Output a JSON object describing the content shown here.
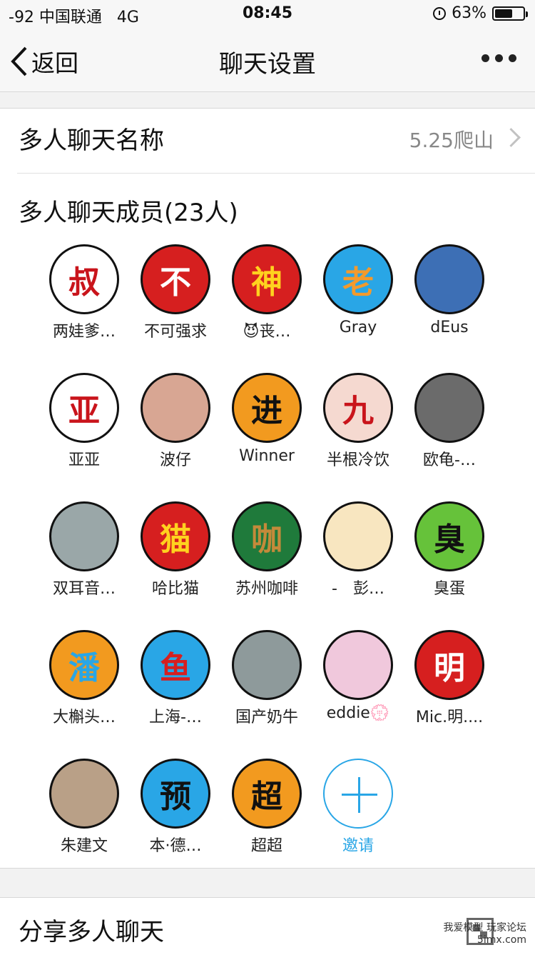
{
  "status": {
    "carrier": "-92 中国联通",
    "network": "4G",
    "time": "08:45",
    "battery": "63%",
    "battery_level": 0.63
  },
  "nav": {
    "back_label": "返回",
    "title": "聊天设置"
  },
  "group_name": {
    "label": "多人聊天名称",
    "value": "5.25爬山"
  },
  "members_title": "多人聊天成员(23人)",
  "members": [
    {
      "name": "两娃爹…",
      "glyph": "叔",
      "color": "#ffffff",
      "fg": "#c9141b",
      "icon": "avatar-red-calligraphy"
    },
    {
      "name": "不可强求",
      "glyph": "不",
      "color": "#d61f1f",
      "fg": "#ffffff",
      "icon": "avatar-canbe"
    },
    {
      "name": "😈丧…",
      "glyph": "神",
      "color": "#d61f1f",
      "fg": "#ffd21f",
      "icon": "avatar-monkey-king"
    },
    {
      "name": "Gray",
      "glyph": "老",
      "color": "#29a6e6",
      "fg": "#f39a2c",
      "icon": "avatar-orange-lao"
    },
    {
      "name": "dEus",
      "glyph": "",
      "color": "#3d6fb5",
      "fg": "#ffffff",
      "icon": "avatar-photo-man"
    },
    {
      "name": "亚亚",
      "glyph": "亚",
      "color": "#ffffff",
      "fg": "#c9141b",
      "icon": "avatar-ya"
    },
    {
      "name": "波仔",
      "glyph": "",
      "color": "#d8a693",
      "fg": "#ffffff",
      "icon": "avatar-photo-child"
    },
    {
      "name": "Winner",
      "glyph": "进",
      "color": "#f29a1f",
      "fg": "#111111",
      "icon": "avatar-winner"
    },
    {
      "name": "半根冷饮",
      "glyph": "九",
      "color": "#f5d9d0",
      "fg": "#c9141b",
      "icon": "avatar-icecream"
    },
    {
      "name": "欧龟-…",
      "glyph": "",
      "color": "#6b6b6b",
      "fg": "#ffffff",
      "icon": "avatar-photo-helmet"
    },
    {
      "name": "双耳音…",
      "glyph": "",
      "color": "#9aa7a8",
      "fg": "#ffffff",
      "icon": "avatar-photo-motorbike"
    },
    {
      "name": "哈比猫",
      "glyph": "猫",
      "color": "#d61f1f",
      "fg": "#ffd21f",
      "icon": "avatar-habimao"
    },
    {
      "name": "苏州咖啡",
      "glyph": "咖",
      "color": "#1f7a3b",
      "fg": "#c48a3a",
      "icon": "avatar-coffee"
    },
    {
      "name": "-　彭…",
      "glyph": "",
      "color": "#f8e6c0",
      "fg": "#555555",
      "icon": "avatar-anime"
    },
    {
      "name": "臭蛋",
      "glyph": "臭",
      "color": "#66c23a",
      "fg": "#111111",
      "icon": "avatar-choudan"
    },
    {
      "name": "大槲头…",
      "glyph": "潘",
      "color": "#f29a1f",
      "fg": "#29a6e6",
      "icon": "avatar-pan"
    },
    {
      "name": "上海-…",
      "glyph": "鱼",
      "color": "#29a6e6",
      "fg": "#d61f1f",
      "icon": "avatar-fish"
    },
    {
      "name": "国产奶牛",
      "glyph": "",
      "color": "#8e9a9b",
      "fg": "#ffffff",
      "icon": "avatar-photo-model"
    },
    {
      "name": "eddie💮",
      "glyph": "",
      "color": "#f0c8dc",
      "fg": "#444444",
      "icon": "avatar-rabbit"
    },
    {
      "name": "Mic.明....",
      "glyph": "明",
      "color": "#d61f1f",
      "fg": "#ffffff",
      "icon": "avatar-michael"
    },
    {
      "name": "朱建文",
      "glyph": "",
      "color": "#b9a087",
      "fg": "#ffffff",
      "icon": "avatar-photo-building"
    },
    {
      "name": "本·德…",
      "glyph": "预",
      "color": "#29a6e6",
      "fg": "#111111",
      "icon": "avatar-yu"
    },
    {
      "name": "超超",
      "glyph": "超",
      "color": "#f29a1f",
      "fg": "#111111",
      "icon": "avatar-chao"
    }
  ],
  "invite_label": "邀请",
  "share": {
    "label": "分享多人聊天"
  },
  "watermark": {
    "line1": "我爱模型 玩家论坛",
    "line2": "5imx.com"
  }
}
